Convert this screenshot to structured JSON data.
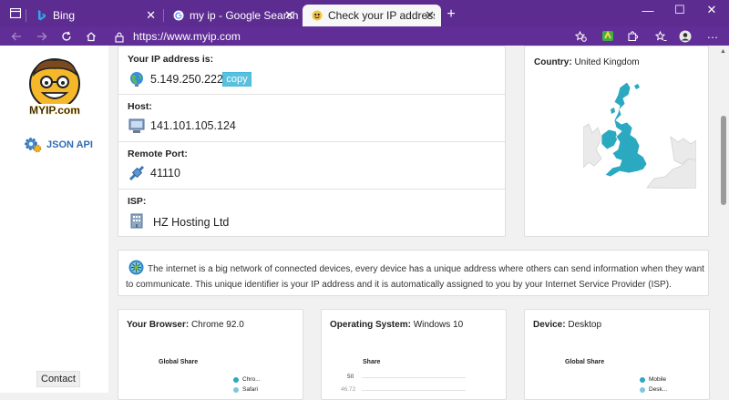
{
  "browser": {
    "tabs": [
      {
        "title": "Bing",
        "favicon": "bing-icon",
        "active": false
      },
      {
        "title": "my ip - Google Search",
        "favicon": "google-icon",
        "active": false
      },
      {
        "title": "Check your IP address | MyIP.co",
        "favicon": "myip-icon",
        "active": true
      }
    ],
    "new_tab_label": "+",
    "window_buttons": {
      "minimize": "—",
      "maximize": "☐",
      "close": "✕"
    },
    "address": "https://www.myip.com",
    "more_menu": "…"
  },
  "sidebar": {
    "logo_text": "MYIP.com",
    "json_api": "JSON API",
    "contact": "Contact"
  },
  "ip_info": {
    "ip_label": "Your IP address is:",
    "ip_value": "5.149.250.222",
    "copy_label": "copy",
    "host_label": "Host:",
    "host_value": "141.101.105.124",
    "port_label": "Remote Port:",
    "port_value": "41110",
    "isp_label": "ISP:",
    "isp_value": "HZ Hosting Ltd"
  },
  "country": {
    "label": "Country:",
    "value": "United Kingdom"
  },
  "info": {
    "text": "The internet is a big network of connected devices, every device has a unique address where others can send information when they want to communicate. This unique identifier is your IP address and it is automatically assigned to you by your Internet Service Provider (ISP)."
  },
  "stats": {
    "browser": {
      "label": "Your Browser:",
      "value": "Chrome 92.0",
      "chart_title": "Global Share",
      "legend": [
        "Chro...",
        "Safari"
      ]
    },
    "os": {
      "label": "Operating System:",
      "value": "Windows 10",
      "chart_title": "Share",
      "ticks": [
        "50",
        "46.72"
      ]
    },
    "device": {
      "label": "Device:",
      "value": "Desktop",
      "chart_title": "Global Share",
      "legend": [
        "Mobile",
        "Desk..."
      ]
    }
  },
  "colors": {
    "tab_bg": "#5d2c91",
    "toolbar_bg": "#602e96",
    "accent": "#2aa9c0",
    "copy_button": "#5bc0de",
    "link": "#2f6db3"
  }
}
